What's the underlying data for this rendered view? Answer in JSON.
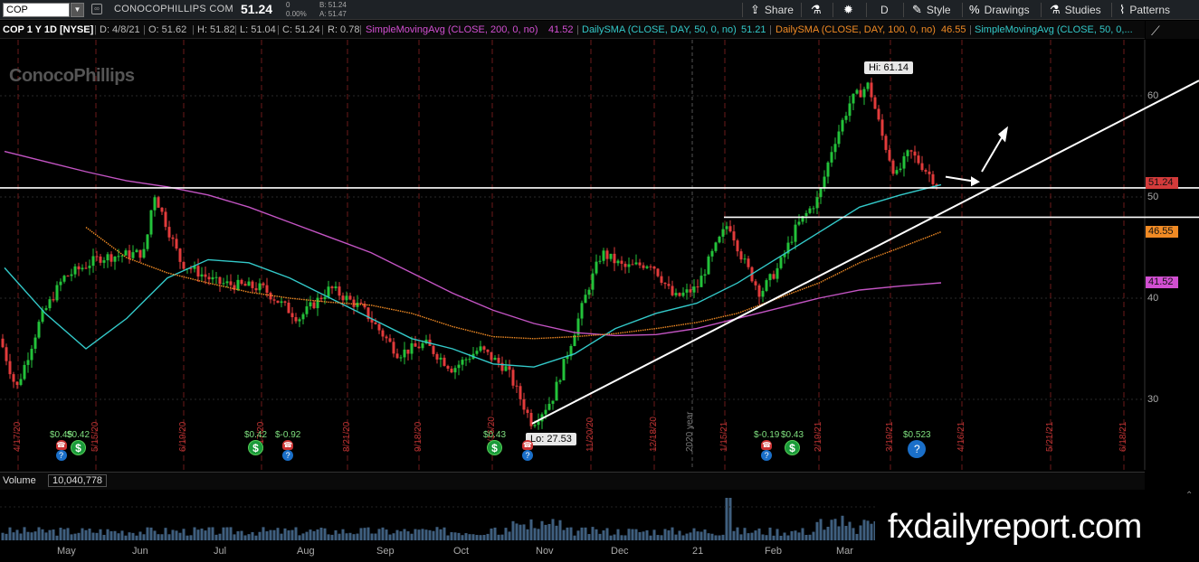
{
  "toolbar": {
    "symbol": "COP",
    "company": "CONOCOPHILLIPS COM",
    "last": "51.24",
    "change": "0",
    "change_pct": "0.00%",
    "bid": "B: 51.24",
    "ask": "A: 51.47",
    "share": "Share",
    "timeframe": "D",
    "style": "Style",
    "drawings": "Drawings",
    "studies": "Studies",
    "patterns": "Patterns"
  },
  "study_bar": {
    "title": "COP 1 Y 1D [NYSE]",
    "date": "D: 4/8/21",
    "open": "O: 51.62",
    "high": "H: 51.82",
    "low": "L: 51.04",
    "close": "C: 51.24",
    "range": "R: 0.78",
    "sma200_label": "SimpleMovingAvg (CLOSE, 200, 0, no)",
    "sma200_value": "41.52",
    "dsma50_label": "DailySMA (CLOSE, DAY, 50, 0, no)",
    "dsma50_value": "51.21",
    "dsma100_label": "DailySMA (CLOSE, DAY, 100, 0, no)",
    "dsma100_value": "46.55",
    "sma50_label": "SimpleMovingAvg (CLOSE, 50, 0,..."
  },
  "watermark": "ConocoPhillips",
  "annotations": {
    "high": "Hi: 61.14",
    "low": "Lo: 27.53"
  },
  "price_axis": {
    "ticks": [
      "60",
      "50",
      "40",
      "30"
    ],
    "labels": [
      {
        "text": "51.24",
        "color": "#d43b3b"
      },
      {
        "text": "46.55",
        "color": "#f08a24"
      },
      {
        "text": "41.52",
        "color": "#d24fd2"
      }
    ]
  },
  "expiry_dates": [
    "4/17/20",
    "5/15/20",
    "6/19/20",
    "7/17/20",
    "8/21/20",
    "9/18/20",
    "10/16/20",
    "11/20/20",
    "12/18/20",
    "1/15/21",
    "2/19/21",
    "3/19/21",
    "4/16/21",
    "5/21/21",
    "6/18/21"
  ],
  "year_label": "2020 year",
  "events": {
    "dividends": [
      "$0.45",
      "$0.42",
      "$0.42",
      "$-0.92",
      "$0.43",
      "$-0.19",
      "$0.43",
      "$0.523"
    ]
  },
  "volume": {
    "label": "Volume",
    "value": "10,040,778"
  },
  "months": [
    "May",
    "Jun",
    "Jul",
    "Aug",
    "Sep",
    "Oct",
    "Nov",
    "Dec",
    "21",
    "Feb",
    "Mar"
  ],
  "brand": "fxdailyreport.com",
  "colors": {
    "up": "#23c23a",
    "down": "#e23b3b",
    "sma50": "#33c9c9",
    "sma100": "#f08a24",
    "sma200": "#c354c3",
    "trend": "#ffffff",
    "arrow": "#ffff66"
  },
  "chart_data": {
    "type": "line",
    "title": "COP 1 Y 1D [NYSE]",
    "ylim": [
      25,
      64
    ],
    "series": [
      {
        "name": "SimpleMovingAvg (CLOSE, 200, 0, no)",
        "values": [
          54.5,
          53.5,
          52.5,
          51.6,
          51.0,
          50.2,
          49.0,
          47.5,
          46.0,
          44.5,
          42.5,
          40.5,
          38.8,
          37.5,
          36.6,
          36.3,
          36.4,
          37.0,
          38.0,
          39.0,
          40.0,
          40.8,
          41.2,
          41.52
        ]
      },
      {
        "name": "DailySMA (CLOSE, DAY, 50, 0, no)",
        "values": [
          43.0,
          38.5,
          35.0,
          38.0,
          42.0,
          43.8,
          43.5,
          42.0,
          40.0,
          38.0,
          36.0,
          35.0,
          33.5,
          33.2,
          34.5,
          37.0,
          38.5,
          39.5,
          41.5,
          44.0,
          46.5,
          49.0,
          50.2,
          51.21
        ]
      },
      {
        "name": "DailySMA (CLOSE, DAY, 100, 0, no)",
        "values": [
          null,
          null,
          47.0,
          44.0,
          42.5,
          41.5,
          40.6,
          40.0,
          39.6,
          39.3,
          38.5,
          37.2,
          36.2,
          36.0,
          36.2,
          36.5,
          37.0,
          37.6,
          38.5,
          40.0,
          41.5,
          43.5,
          45.0,
          46.55
        ]
      }
    ],
    "high": 61.14,
    "low": 27.53,
    "last": 51.24
  }
}
